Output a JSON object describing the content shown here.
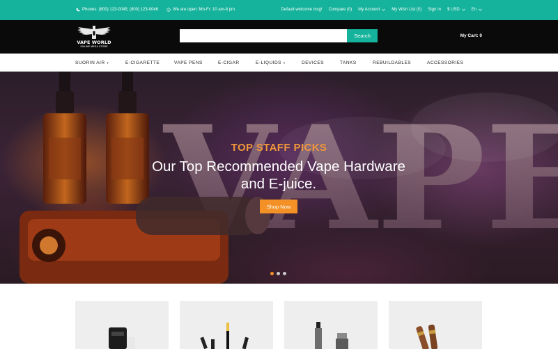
{
  "topbar": {
    "phone": "Phones: (800) 123-0045; (800) 123-0046",
    "hours": "We are open: Mn-Fr: 10 am-8 pm",
    "welcome": "Default welcome msg!",
    "compare": "Compare (0)",
    "account": "My Account",
    "wishlist": "My Wish List (0)",
    "signin": "Sign In",
    "currency": "$ USD",
    "language": "En"
  },
  "header": {
    "logo_brand": "VAPE WORLD",
    "logo_tagline": "ONLINE MEGA STORE",
    "search_placeholder": "",
    "search_button": "Search",
    "cart": "My Cart: 0"
  },
  "nav": {
    "items": [
      {
        "label": "SUORIN AIR",
        "has_dropdown": true
      },
      {
        "label": "E-CIGARETTE",
        "has_dropdown": false
      },
      {
        "label": "VAPE PENS",
        "has_dropdown": false
      },
      {
        "label": "E-CIGAR",
        "has_dropdown": false
      },
      {
        "label": "E-LIQUIDS",
        "has_dropdown": true
      },
      {
        "label": "DEVICES",
        "has_dropdown": false
      },
      {
        "label": "TANKS",
        "has_dropdown": false
      },
      {
        "label": "REBUILDABLES",
        "has_dropdown": false
      },
      {
        "label": "ACCESSORIES",
        "has_dropdown": false
      }
    ]
  },
  "hero": {
    "kicker": "TOP STAFF PICKS",
    "title": "Our Top Recommended Vape Hardware and E-juice.",
    "button": "Shop Now",
    "background_letters": "VAPE",
    "slides": 3,
    "active_slide": 1
  },
  "products": {
    "cards": [
      {
        "image": "vape-mod-device"
      },
      {
        "image": "vape-pens"
      },
      {
        "image": "vape-tank-atomizers"
      },
      {
        "image": "e-cigars"
      }
    ]
  },
  "colors": {
    "teal": "#15b39b",
    "orange": "#f39127",
    "header_bg": "#0a0a0a"
  }
}
